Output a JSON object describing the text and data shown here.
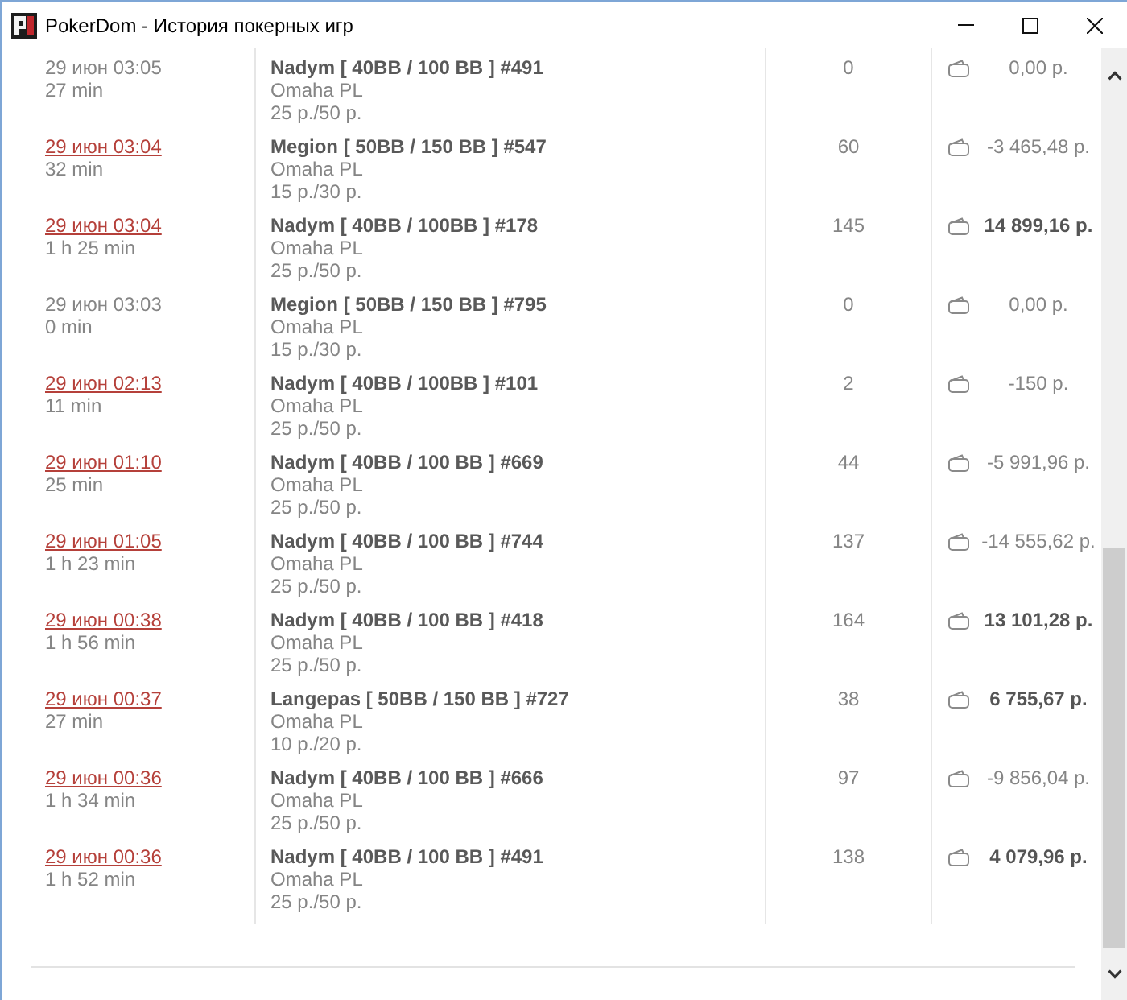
{
  "window": {
    "title": "PokerDom - История покерных игр"
  },
  "games": [
    {
      "date": "29 июн 03:05",
      "link": false,
      "duration": "27 min",
      "table": "Nadym [ 40BB / 100 BB ] #491",
      "game": "Omaha PL",
      "stakes": "25 р./50 р.",
      "hands": "0",
      "result": "0,00 р.",
      "positive": false
    },
    {
      "date": "29 июн 03:04",
      "link": true,
      "duration": "32 min",
      "table": "Megion [ 50BB / 150 BB ] #547",
      "game": "Omaha PL",
      "stakes": "15 р./30 р.",
      "hands": "60",
      "result": "-3 465,48 р.",
      "positive": false
    },
    {
      "date": "29 июн 03:04",
      "link": true,
      "duration": "1 h 25 min",
      "table": "Nadym [ 40BB / 100BB ] #178",
      "game": "Omaha PL",
      "stakes": "25 р./50 р.",
      "hands": "145",
      "result": "14 899,16 р.",
      "positive": true
    },
    {
      "date": "29 июн 03:03",
      "link": false,
      "duration": "0 min",
      "table": "Megion [ 50BB / 150 BB ] #795",
      "game": "Omaha PL",
      "stakes": "15 р./30 р.",
      "hands": "0",
      "result": "0,00 р.",
      "positive": false
    },
    {
      "date": "29 июн 02:13",
      "link": true,
      "duration": "11 min",
      "table": "Nadym [ 40BB / 100BB ] #101",
      "game": "Omaha PL",
      "stakes": "25 р./50 р.",
      "hands": "2",
      "result": "-150 р.",
      "positive": false
    },
    {
      "date": "29 июн 01:10",
      "link": true,
      "duration": "25 min",
      "table": "Nadym [ 40BB / 100 BB ] #669",
      "game": "Omaha PL",
      "stakes": "25 р./50 р.",
      "hands": "44",
      "result": "-5 991,96 р.",
      "positive": false
    },
    {
      "date": "29 июн 01:05",
      "link": true,
      "duration": "1 h 23 min",
      "table": "Nadym [ 40BB / 100 BB ] #744",
      "game": "Omaha PL",
      "stakes": "25 р./50 р.",
      "hands": "137",
      "result": "-14 555,62 р.",
      "positive": false
    },
    {
      "date": "29 июн 00:38",
      "link": true,
      "duration": "1 h 56 min",
      "table": "Nadym [ 40BB / 100 BB ] #418",
      "game": "Omaha PL",
      "stakes": "25 р./50 р.",
      "hands": "164",
      "result": "13 101,28 р.",
      "positive": true
    },
    {
      "date": "29 июн 00:37",
      "link": true,
      "duration": "27 min",
      "table": "Langepas [ 50BB / 150 BB ] #727",
      "game": "Omaha PL",
      "stakes": "10 р./20 р.",
      "hands": "38",
      "result": "6 755,67 р.",
      "positive": true
    },
    {
      "date": "29 июн 00:36",
      "link": true,
      "duration": "1 h 34 min",
      "table": "Nadym [ 40BB / 100 BB ] #666",
      "game": "Omaha PL",
      "stakes": "25 р./50 р.",
      "hands": "97",
      "result": "-9 856,04 р.",
      "positive": false
    },
    {
      "date": "29 июн 00:36",
      "link": true,
      "duration": "1 h 52 min",
      "table": "Nadym [ 40BB / 100 BB ] #491",
      "game": "Omaha PL",
      "stakes": "25 р./50 р.",
      "hands": "138",
      "result": "4 079,96 р.",
      "positive": true
    }
  ]
}
